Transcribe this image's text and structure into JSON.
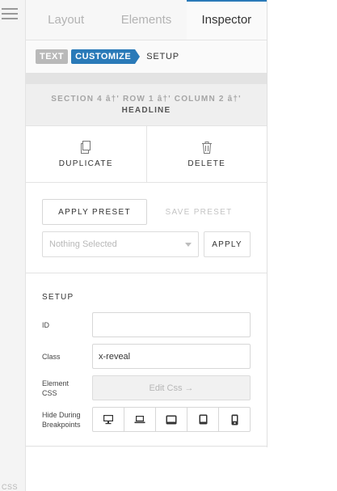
{
  "rail": {
    "css_label": "CSS"
  },
  "tabs": [
    {
      "label": "Layout"
    },
    {
      "label": "Elements"
    },
    {
      "label": "Inspector"
    }
  ],
  "breadcrumb": {
    "items": [
      {
        "label": "TEXT"
      },
      {
        "label": "CUSTOMIZE"
      }
    ],
    "current": "SETUP"
  },
  "path": {
    "line": "SECTION 4 â†' ROW 1 â†' COLUMN 2 â†'",
    "element": "HEADLINE"
  },
  "actions": {
    "duplicate_label": "DUPLICATE",
    "delete_label": "DELETE"
  },
  "preset": {
    "apply_preset_label": "APPLY PRESET",
    "save_preset_label": "SAVE PRESET",
    "select_value": "Nothing Selected",
    "apply_label": "APPLY"
  },
  "setup": {
    "title": "SETUP",
    "id_label": "ID",
    "id_value": "",
    "class_label": "Class",
    "class_value": "x-reveal",
    "element_css_label_line1": "Element",
    "element_css_label_line2": "CSS",
    "edit_css_label": "Edit Css →",
    "hide_label_line1": "Hide During",
    "hide_label_line2": "Breakpoints",
    "breakpoints": [
      "desktop-icon",
      "laptop-icon",
      "tablet-landscape-icon",
      "tablet-portrait-icon",
      "phone-icon"
    ]
  },
  "colors": {
    "accent": "#2a7ab8",
    "text_badge": "#b9b9b9"
  }
}
